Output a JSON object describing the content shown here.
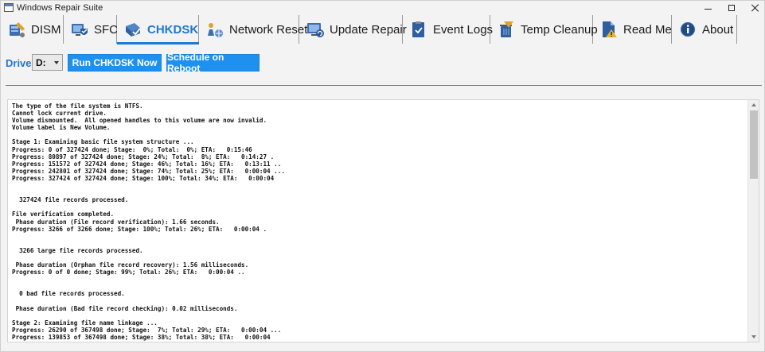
{
  "window": {
    "title": "Windows Repair Suite"
  },
  "tabs": [
    {
      "label": "DISM",
      "icon": "dism-icon"
    },
    {
      "label": "SFC",
      "icon": "sfc-icon"
    },
    {
      "label": "CHKDSK",
      "icon": "chkdsk-icon",
      "active": true
    },
    {
      "label": "Network Reset",
      "icon": "network-icon"
    },
    {
      "label": "Update Repair",
      "icon": "update-icon"
    },
    {
      "label": "Event Logs",
      "icon": "event-logs-icon"
    },
    {
      "label": "Temp Cleanup",
      "icon": "temp-cleanup-icon"
    },
    {
      "label": "Read Me",
      "icon": "read-me-icon"
    },
    {
      "label": "About",
      "icon": "about-icon"
    }
  ],
  "toolbar": {
    "drive_label": "Drive:",
    "drive_value": "D:",
    "run_button": "Run CHKDSK Now",
    "reboot_button": "Schedule on Reboot"
  },
  "colors": {
    "accent": "#1e78d4",
    "button": "#1e90ef"
  },
  "output": {
    "lines": [
      "The type of the file system is NTFS.",
      "Cannot lock current drive.",
      "Volume dismounted.  All opened handles to this volume are now invalid.",
      "Volume label is New Volume.",
      "",
      "Stage 1: Examining basic file system structure ...",
      "Progress: 0 of 327424 done; Stage:  0%; Total:  0%; ETA:   0:15:46",
      "Progress: 80897 of 327424 done; Stage: 24%; Total:  8%; ETA:   0:14:27 .",
      "Progress: 151572 of 327424 done; Stage: 46%; Total: 16%; ETA:   0:13:11 ..",
      "Progress: 242801 of 327424 done; Stage: 74%; Total: 25%; ETA:   0:00:04 ...",
      "Progress: 327424 of 327424 done; Stage: 100%; Total: 34%; ETA:   0:00:04",
      "",
      "",
      "  327424 file records processed.",
      "",
      "File verification completed.",
      " Phase duration (File record verification): 1.66 seconds.",
      "Progress: 3266 of 3266 done; Stage: 100%; Total: 26%; ETA:   0:00:04 .",
      "",
      "",
      "  3266 large file records processed.",
      "",
      " Phase duration (Orphan file record recovery): 1.56 milliseconds.",
      "Progress: 0 of 0 done; Stage: 99%; Total: 26%; ETA:   0:00:04 ..",
      "",
      "",
      "  0 bad file records processed.",
      "",
      " Phase duration (Bad file record checking): 0.02 milliseconds.",
      "",
      "Stage 2: Examining file name linkage ...",
      "Progress: 26290 of 367498 done; Stage:  7%; Total: 29%; ETA:   0:00:04 ...",
      "Progress: 139853 of 367498 done; Stage: 38%; Total: 38%; ETA:   0:00:04"
    ]
  }
}
